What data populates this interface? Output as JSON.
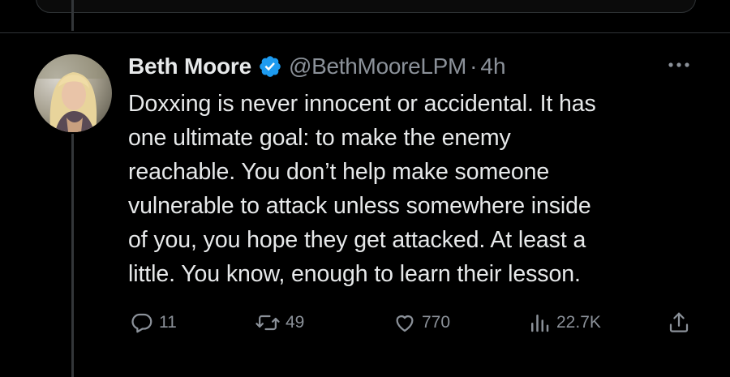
{
  "tweet": {
    "author_name": "Beth Moore",
    "author_handle": "@BethMooreLPM",
    "separator": "·",
    "time": "4h",
    "verified": true,
    "text_lines": [
      "Doxxing is never innocent or accidental. It has",
      "one ultimate goal: to make the enemy",
      "reachable. You don’t help make someone",
      "vulnerable to attack unless somewhere inside",
      "of you, you hope they get attacked. At least a",
      "little. You know, enough to learn their lesson."
    ]
  },
  "actions": {
    "replies": "11",
    "retweets": "49",
    "likes": "770",
    "views": "22.7K"
  },
  "icons": {
    "reply": "reply-icon",
    "retweet": "retweet-icon",
    "like": "heart-icon",
    "views": "views-icon",
    "share": "share-icon",
    "more": "more-icon",
    "verified": "verified-badge-icon"
  },
  "colors": {
    "background": "#000000",
    "text": "#e7e9ea",
    "secondary": "#8b9199",
    "verified": "#1d9bf0",
    "border": "#2f3336"
  }
}
